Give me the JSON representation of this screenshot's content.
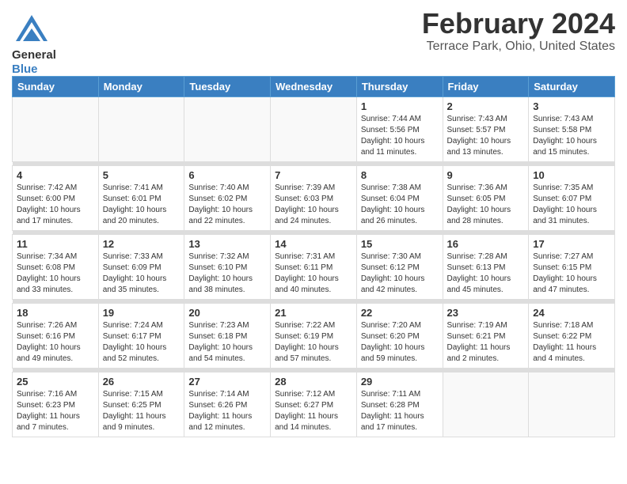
{
  "header": {
    "title": "February 2024",
    "location": "Terrace Park, Ohio, United States"
  },
  "logo": {
    "line1": "General",
    "line2": "Blue"
  },
  "weekdays": [
    "Sunday",
    "Monday",
    "Tuesday",
    "Wednesday",
    "Thursday",
    "Friday",
    "Saturday"
  ],
  "weeks": [
    [
      {
        "day": "",
        "info": ""
      },
      {
        "day": "",
        "info": ""
      },
      {
        "day": "",
        "info": ""
      },
      {
        "day": "",
        "info": ""
      },
      {
        "day": "1",
        "info": "Sunrise: 7:44 AM\nSunset: 5:56 PM\nDaylight: 10 hours\nand 11 minutes."
      },
      {
        "day": "2",
        "info": "Sunrise: 7:43 AM\nSunset: 5:57 PM\nDaylight: 10 hours\nand 13 minutes."
      },
      {
        "day": "3",
        "info": "Sunrise: 7:43 AM\nSunset: 5:58 PM\nDaylight: 10 hours\nand 15 minutes."
      }
    ],
    [
      {
        "day": "4",
        "info": "Sunrise: 7:42 AM\nSunset: 6:00 PM\nDaylight: 10 hours\nand 17 minutes."
      },
      {
        "day": "5",
        "info": "Sunrise: 7:41 AM\nSunset: 6:01 PM\nDaylight: 10 hours\nand 20 minutes."
      },
      {
        "day": "6",
        "info": "Sunrise: 7:40 AM\nSunset: 6:02 PM\nDaylight: 10 hours\nand 22 minutes."
      },
      {
        "day": "7",
        "info": "Sunrise: 7:39 AM\nSunset: 6:03 PM\nDaylight: 10 hours\nand 24 minutes."
      },
      {
        "day": "8",
        "info": "Sunrise: 7:38 AM\nSunset: 6:04 PM\nDaylight: 10 hours\nand 26 minutes."
      },
      {
        "day": "9",
        "info": "Sunrise: 7:36 AM\nSunset: 6:05 PM\nDaylight: 10 hours\nand 28 minutes."
      },
      {
        "day": "10",
        "info": "Sunrise: 7:35 AM\nSunset: 6:07 PM\nDaylight: 10 hours\nand 31 minutes."
      }
    ],
    [
      {
        "day": "11",
        "info": "Sunrise: 7:34 AM\nSunset: 6:08 PM\nDaylight: 10 hours\nand 33 minutes."
      },
      {
        "day": "12",
        "info": "Sunrise: 7:33 AM\nSunset: 6:09 PM\nDaylight: 10 hours\nand 35 minutes."
      },
      {
        "day": "13",
        "info": "Sunrise: 7:32 AM\nSunset: 6:10 PM\nDaylight: 10 hours\nand 38 minutes."
      },
      {
        "day": "14",
        "info": "Sunrise: 7:31 AM\nSunset: 6:11 PM\nDaylight: 10 hours\nand 40 minutes."
      },
      {
        "day": "15",
        "info": "Sunrise: 7:30 AM\nSunset: 6:12 PM\nDaylight: 10 hours\nand 42 minutes."
      },
      {
        "day": "16",
        "info": "Sunrise: 7:28 AM\nSunset: 6:13 PM\nDaylight: 10 hours\nand 45 minutes."
      },
      {
        "day": "17",
        "info": "Sunrise: 7:27 AM\nSunset: 6:15 PM\nDaylight: 10 hours\nand 47 minutes."
      }
    ],
    [
      {
        "day": "18",
        "info": "Sunrise: 7:26 AM\nSunset: 6:16 PM\nDaylight: 10 hours\nand 49 minutes."
      },
      {
        "day": "19",
        "info": "Sunrise: 7:24 AM\nSunset: 6:17 PM\nDaylight: 10 hours\nand 52 minutes."
      },
      {
        "day": "20",
        "info": "Sunrise: 7:23 AM\nSunset: 6:18 PM\nDaylight: 10 hours\nand 54 minutes."
      },
      {
        "day": "21",
        "info": "Sunrise: 7:22 AM\nSunset: 6:19 PM\nDaylight: 10 hours\nand 57 minutes."
      },
      {
        "day": "22",
        "info": "Sunrise: 7:20 AM\nSunset: 6:20 PM\nDaylight: 10 hours\nand 59 minutes."
      },
      {
        "day": "23",
        "info": "Sunrise: 7:19 AM\nSunset: 6:21 PM\nDaylight: 11 hours\nand 2 minutes."
      },
      {
        "day": "24",
        "info": "Sunrise: 7:18 AM\nSunset: 6:22 PM\nDaylight: 11 hours\nand 4 minutes."
      }
    ],
    [
      {
        "day": "25",
        "info": "Sunrise: 7:16 AM\nSunset: 6:23 PM\nDaylight: 11 hours\nand 7 minutes."
      },
      {
        "day": "26",
        "info": "Sunrise: 7:15 AM\nSunset: 6:25 PM\nDaylight: 11 hours\nand 9 minutes."
      },
      {
        "day": "27",
        "info": "Sunrise: 7:14 AM\nSunset: 6:26 PM\nDaylight: 11 hours\nand 12 minutes."
      },
      {
        "day": "28",
        "info": "Sunrise: 7:12 AM\nSunset: 6:27 PM\nDaylight: 11 hours\nand 14 minutes."
      },
      {
        "day": "29",
        "info": "Sunrise: 7:11 AM\nSunset: 6:28 PM\nDaylight: 11 hours\nand 17 minutes."
      },
      {
        "day": "",
        "info": ""
      },
      {
        "day": "",
        "info": ""
      }
    ]
  ]
}
